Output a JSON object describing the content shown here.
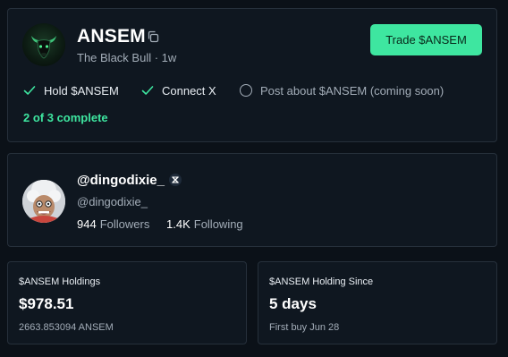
{
  "token": {
    "name": "ANSEM",
    "subtitle": "The Black Bull · 1w",
    "logo_icon": "black-bull-logo",
    "trade_label": "Trade $ANSEM"
  },
  "tasks": [
    {
      "label": "Hold $ANSEM",
      "status": "done"
    },
    {
      "label": "Connect X",
      "status": "done"
    },
    {
      "label": "Post about $ANSEM (coming soon)",
      "status": "pending"
    }
  ],
  "progress": {
    "text": "2 of 3 complete",
    "completed": 2,
    "total": 3
  },
  "profile": {
    "display_name": "@dingodixie_",
    "handle": "@dingodixie_",
    "badge_icon": "x-badge-icon",
    "followers_count": "944",
    "followers_label": "Followers",
    "following_count": "1.4K",
    "following_label": "Following"
  },
  "holdings": {
    "title": "$ANSEM Holdings",
    "value": "$978.51",
    "amount": "2663.853094 ANSEM"
  },
  "holding_since": {
    "title": "$ANSEM Holding Since",
    "value": "5 days",
    "first_buy": "First buy Jun 28"
  },
  "colors": {
    "background": "#0b1118",
    "card": "#0f1720",
    "border": "#26303b",
    "accent": "#3ee6a0",
    "muted_text": "#a3adb8"
  }
}
